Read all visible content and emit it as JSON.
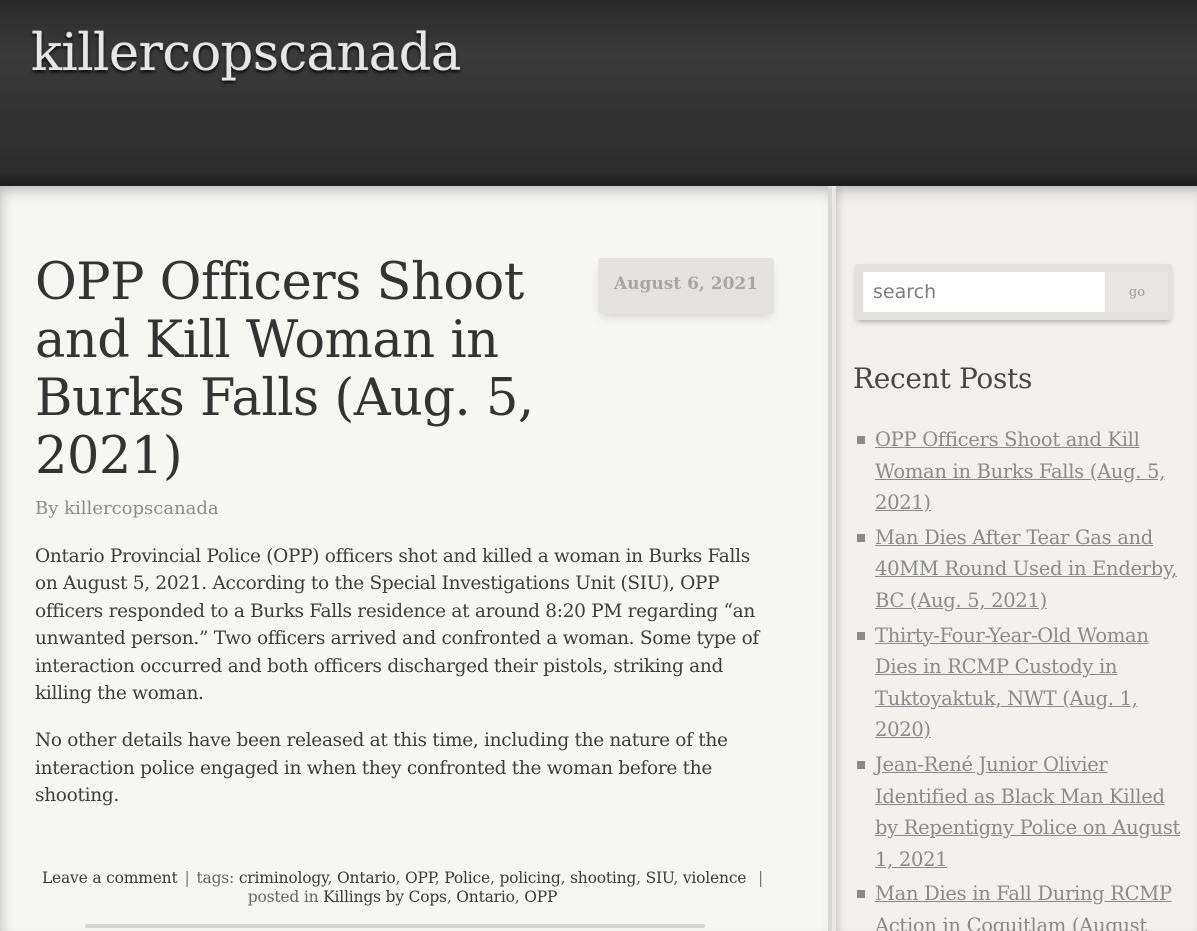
{
  "site": {
    "title": "killercopscanada"
  },
  "post": {
    "title": "OPP Officers Shoot and Kill Woman in Burks Falls (Aug. 5, 2021)",
    "date": "August 6, 2021",
    "byline_prefix": "By",
    "author": "killercopscanada",
    "paragraphs": [
      "Ontario Provincial Police (OPP) officers shot and killed a woman in Burks Falls on August 5, 2021. According to the Special Investigations Unit (SIU), OPP officers responded to a Burks Falls residence at around 8:20 PM regarding “an unwanted person.” Two officers arrived and confronted a woman. Some type of interaction occurred and both officers discharged their pistols, striking and killing the woman.",
      "No other details have been released at this time, including the nature of the interaction police engaged in when they confronted the woman before the shooting."
    ],
    "footer": {
      "comment_link": "Leave a comment",
      "tags_label": "tags:",
      "tags": [
        "criminology",
        "Ontario",
        "OPP",
        "Police",
        "policing",
        "shooting",
        "SIU",
        "violence"
      ],
      "posted_label": "posted in",
      "categories": [
        "Killings by Cops",
        "Ontario",
        "OPP"
      ]
    }
  },
  "sidebar": {
    "search": {
      "placeholder": "search",
      "button_label": "go"
    },
    "recent_heading": "Recent Posts",
    "recent_posts": [
      "OPP Officers Shoot and Kill Woman in Burks Falls (Aug. 5, 2021)",
      "Man Dies After Tear Gas and 40MM Round Used in Enderby, BC (Aug. 5, 2021)",
      "Thirty-Four-Year-Old Woman Dies in RCMP Custody in Tuktoyaktuk, NWT (Aug. 1, 2020)",
      "Jean-René Junior Olivier Identified as Black Man Killed by Repentigny Police on August 1, 2021",
      "Man Dies in Fall During RCMP Action in Coquitlam (August"
    ]
  }
}
